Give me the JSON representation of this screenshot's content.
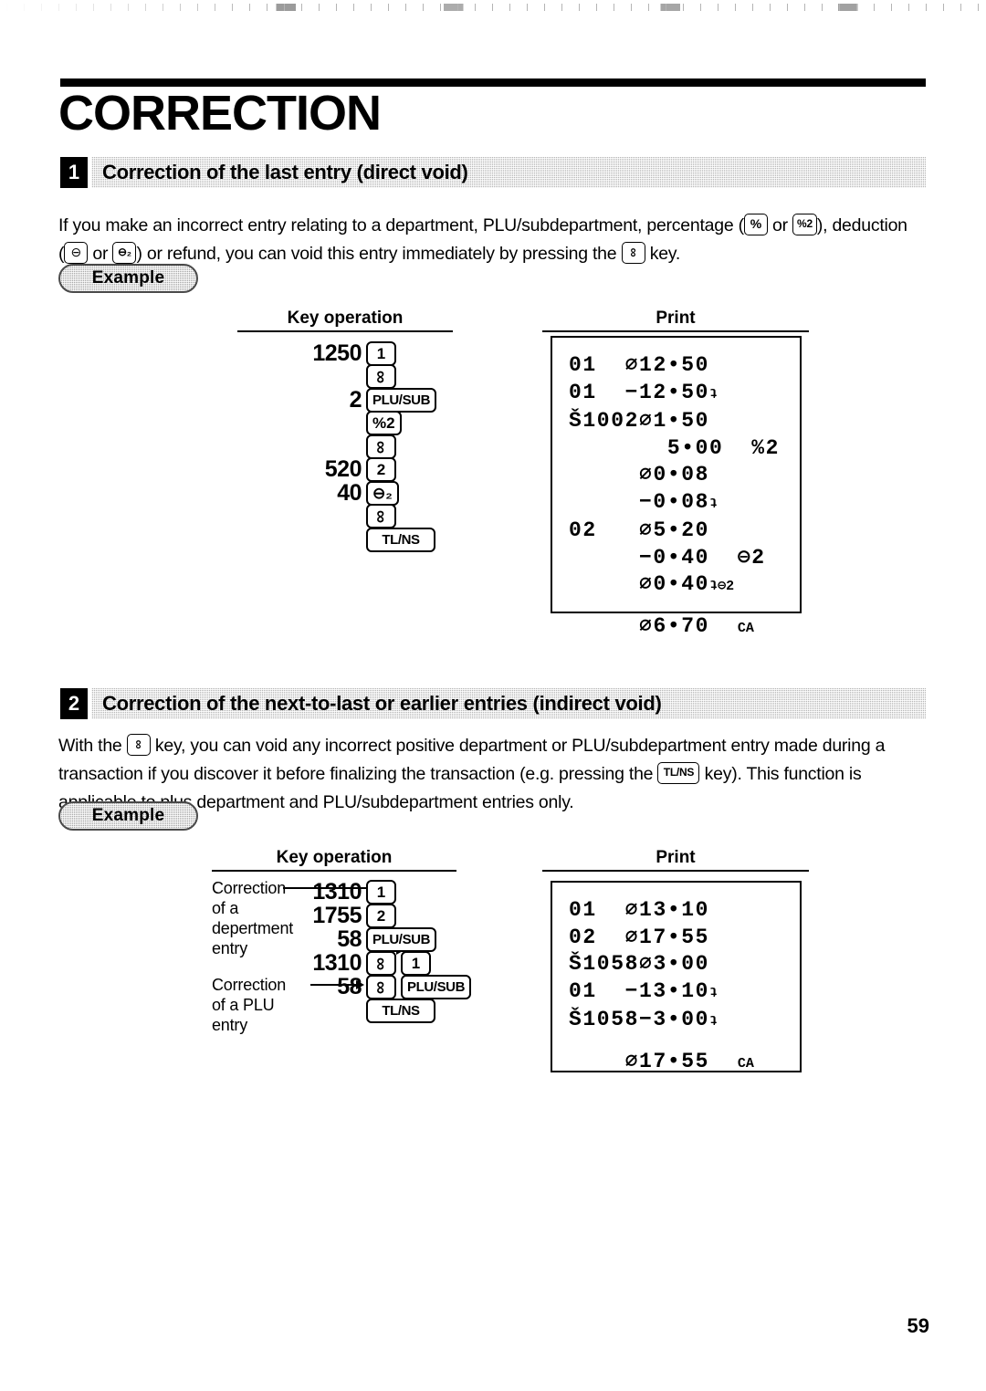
{
  "document": {
    "title": "CORRECTION",
    "page_number": "59"
  },
  "sections": [
    {
      "number": "1",
      "heading": "Correction of the last entry (direct void)",
      "body": {
        "part1": "If you make an incorrect entry relating to a department, PLU/subdepartment, percentage (",
        "key_percent": "%",
        "or1": " or ",
        "key_percent2": "%2",
        "part2": "), deduction",
        "part3": "(",
        "key_minus": "⊖",
        "or2": " or ",
        "key_minus2": "⊖₂",
        "part4": ") or refund, you can void this entry immediately by pressing the ",
        "key_void": "∞",
        "part5": " key."
      },
      "example_label": "Example",
      "columns": {
        "key_operation": "Key operation",
        "print": "Print"
      },
      "key_operation_rows": [
        {
          "number": "1250",
          "keys": [
            {
              "label": "1",
              "type": "num"
            }
          ]
        },
        {
          "number": "",
          "keys": [
            {
              "label": "∞",
              "type": "void"
            }
          ]
        },
        {
          "number": "2",
          "keys": [
            {
              "label": "PLU/SUB",
              "type": "wide"
            }
          ]
        },
        {
          "number": "",
          "keys": [
            {
              "label": "%2",
              "type": "num"
            }
          ]
        },
        {
          "number": "",
          "keys": [
            {
              "label": "∞",
              "type": "void"
            }
          ]
        },
        {
          "number": "520",
          "keys": [
            {
              "label": "2",
              "type": "num"
            }
          ]
        },
        {
          "number": "40",
          "keys": [
            {
              "label": "⊖₂",
              "type": "num"
            }
          ]
        },
        {
          "number": "",
          "keys": [
            {
              "label": "∞",
              "type": "void"
            }
          ]
        },
        {
          "number": "",
          "keys": [
            {
              "label": "TL/NS",
              "type": "wide"
            }
          ]
        }
      ],
      "receipt_lines": [
        {
          "text": "01  ∅12•50",
          "suffix": ""
        },
        {
          "text": "01  −12•50",
          "suffix": "ʇ"
        },
        {
          "text": "Š1002∅1•50",
          "suffix": ""
        },
        {
          "text": "       5•00  %2",
          "suffix": ""
        },
        {
          "text": "     ∅0•08",
          "suffix": ""
        },
        {
          "text": "     −0•08",
          "suffix": "ʇ"
        },
        {
          "text": "02   ∅5•20",
          "suffix": ""
        },
        {
          "text": "     −0•40  ⊖2",
          "suffix": ""
        },
        {
          "text": "     ∅0•40",
          "suffix": "ʇ⊖2"
        },
        {
          "text": "",
          "suffix": ""
        },
        {
          "text": "     ∅6•70  ",
          "suffix": "CA"
        }
      ]
    },
    {
      "number": "2",
      "heading": "Correction of the next-to-last or earlier entries (indirect void)",
      "body": {
        "part1": "With the ",
        "key_void": "∞",
        "part2": " key, you can void any incorrect positive department or PLU/subdepartment entry made during a",
        "part3": "transaction if you discover it before finalizing the transaction (e.g. pressing the ",
        "key_tlns": "TL/NS",
        "part4": " key).  This function is",
        "part5": "applicable to plus department and PLU/subdepartment entries only."
      },
      "example_label": "Example",
      "columns": {
        "key_operation": "Key operation",
        "print": "Print"
      },
      "annotations": [
        {
          "lines": [
            "Correction",
            "of a",
            "depertment",
            "entry"
          ]
        },
        {
          "lines": [
            "Correction",
            "of a PLU",
            "entry"
          ]
        }
      ],
      "key_operation_rows": [
        {
          "number": "1310",
          "keys": [
            {
              "label": "1",
              "type": "num"
            }
          ]
        },
        {
          "number": "1755",
          "keys": [
            {
              "label": "2",
              "type": "num"
            }
          ]
        },
        {
          "number": "58",
          "keys": [
            {
              "label": "PLU/SUB",
              "type": "wide"
            }
          ]
        },
        {
          "number": "1310",
          "keys": [
            {
              "label": "∞",
              "type": "void"
            },
            {
              "label": "1",
              "type": "num"
            }
          ]
        },
        {
          "number": "58",
          "keys": [
            {
              "label": "∞",
              "type": "void"
            },
            {
              "label": "PLU/SUB",
              "type": "wide"
            }
          ]
        },
        {
          "number": "",
          "keys": [
            {
              "label": "TL/NS",
              "type": "wide"
            }
          ]
        }
      ],
      "receipt_lines": [
        {
          "text": "01  ∅13•10",
          "suffix": ""
        },
        {
          "text": "02  ∅17•55",
          "suffix": ""
        },
        {
          "text": "Š1058∅3•00",
          "suffix": ""
        },
        {
          "text": "01  −13•10",
          "suffix": "ʇ"
        },
        {
          "text": "Š1058−3•00",
          "suffix": "ʇ"
        },
        {
          "text": "",
          "suffix": ""
        },
        {
          "text": "    ∅17•55  ",
          "suffix": "CA"
        }
      ]
    }
  ]
}
